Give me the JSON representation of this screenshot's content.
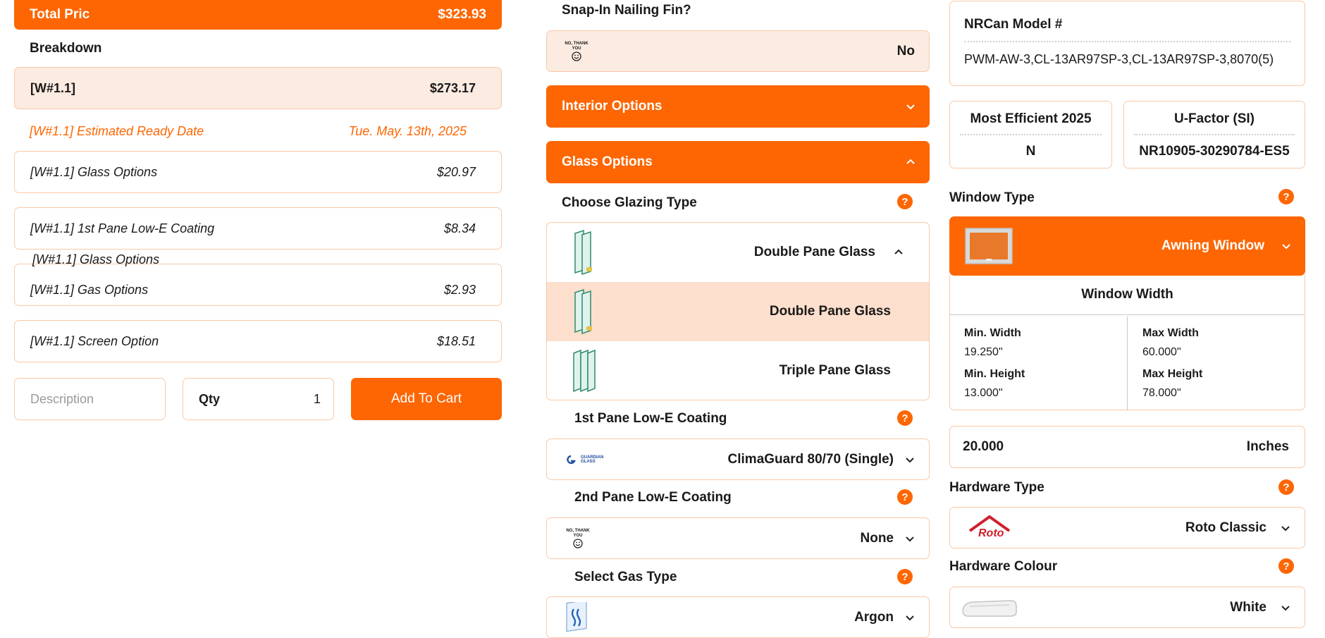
{
  "summary": {
    "total_label": "Total Pric",
    "total_value": "$323.93",
    "breakdown_title": "Breakdown",
    "item": {
      "label": "[W#1.1]",
      "value": "$273.17"
    },
    "ready": {
      "label": "[W#1.1] Estimated Ready Date",
      "value": "Tue. May. 13th, 2025"
    },
    "options": [
      {
        "label": "[W#1.1] Glass Options",
        "value": "$20.97"
      },
      {
        "label": "[W#1.1] 1st Pane Low-E Coating",
        "value": "$8.34"
      },
      {
        "label": "[W#1.1] Gas Options",
        "value": "$2.93"
      },
      {
        "label": "[W#1.1] Screen Option",
        "value": "$18.51"
      }
    ],
    "stray_label": "[W#1.1] Glass Options"
  },
  "cart": {
    "description_placeholder": "Description",
    "qty_label": "Qty",
    "qty_value": "1",
    "add_label": "Add To Cart"
  },
  "middle": {
    "snap_title": "Snap-In Nailing Fin?",
    "snap_value": "No",
    "no_thanks_text": "NO, THANK YOU",
    "interior_label": "Interior Options",
    "glass_label": "Glass Options",
    "glazing_title": "Choose Glazing Type",
    "glazing_options": [
      "Double Pane Glass",
      "Double Pane Glass",
      "Triple Pane Glass"
    ],
    "lowe1_title": "1st Pane Low-E Coating",
    "lowe1_value": "ClimaGuard 80/70 (Single)",
    "guardian_logo_text": "GUARDIAN GLASS",
    "lowe2_title": "2nd Pane Low-E Coating",
    "lowe2_value": "None",
    "gas_title": "Select Gas Type",
    "gas_value": "Argon",
    "help_glyph": "?"
  },
  "right": {
    "nrcan_label": "NRCan Model #",
    "nrcan_value": "PWM-AW-3,CL-13AR97SP-3,CL-13AR97SP-3,8070(5)",
    "efficient_label": "Most Efficient 2025",
    "efficient_value": "N",
    "ufactor_label": "U-Factor (SI)",
    "ufactor_value": "NR10905-30290784-ES5",
    "window_type_title": "Window Type",
    "window_type_value": "Awning Window",
    "window_width_title": "Window Width",
    "min_width_label": "Min. Width",
    "min_width_value": "19.250\"",
    "max_width_label": "Max Width",
    "max_width_value": "60.000\"",
    "min_height_label": "Min. Height",
    "min_height_value": "13.000\"",
    "max_height_label": "Max Height",
    "max_height_value": "78.000\"",
    "width_value": "20.000",
    "width_unit": "Inches",
    "hardware_type_title": "Hardware Type",
    "hardware_type_value": "Roto Classic",
    "roto_logo_text": "Roto",
    "hardware_colour_title": "Hardware Colour",
    "hardware_colour_value": "White"
  },
  "colors": {
    "accent": "#fd6602",
    "peach": "#fcebe1",
    "border": "#f9c9a7"
  },
  "icons": [
    "no-thanks-icon",
    "chevron-down-icon",
    "chevron-up-icon",
    "help-icon",
    "double-pane-glass-icon",
    "triple-pane-glass-icon",
    "guardian-glass-logo",
    "gas-argon-icon",
    "awning-window-icon",
    "roto-logo",
    "handle-white-icon"
  ]
}
